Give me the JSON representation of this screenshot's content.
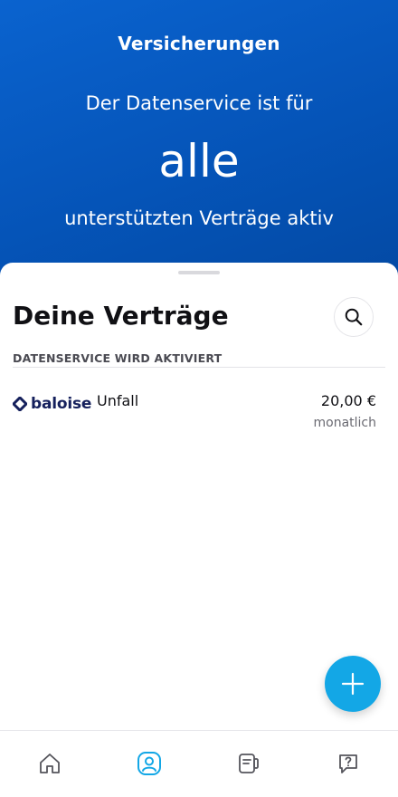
{
  "hero": {
    "title": "Versicherungen",
    "line1": "Der Datenservice ist für",
    "highlight": "alle",
    "line2": "unterstützten Verträge aktiv",
    "background_color": "#0554b8"
  },
  "contracts_sheet": {
    "title": "Deine Verträge",
    "search_icon": "search-icon",
    "section_header": "DATENSERVICE WIRD AKTIVIERT",
    "items": [
      {
        "provider": "baloise",
        "provider_color": "#15205c",
        "name": "Unfall",
        "amount": "20,00 €",
        "period": "monatlich"
      }
    ]
  },
  "fab": {
    "icon": "plus-icon",
    "color": "#13a7e6"
  },
  "bottom_nav": {
    "items": [
      {
        "icon": "home-icon",
        "active": false
      },
      {
        "icon": "profile-icon",
        "active": true
      },
      {
        "icon": "contracts-icon",
        "active": false
      },
      {
        "icon": "help-icon",
        "active": false
      }
    ],
    "active_color": "#13a7e6",
    "inactive_color": "#55555c"
  }
}
